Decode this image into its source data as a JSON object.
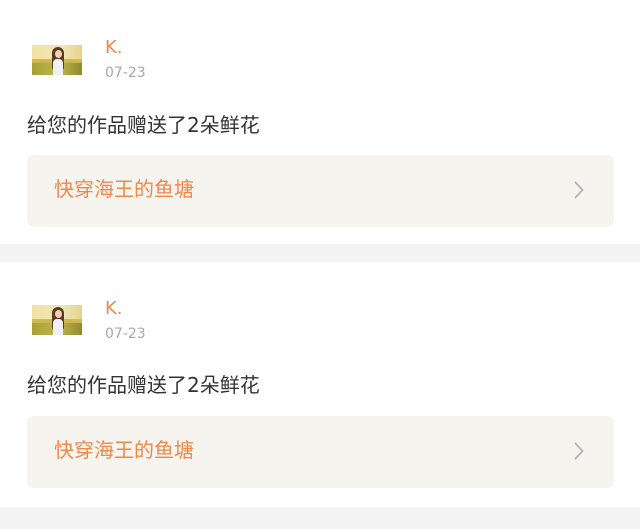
{
  "notifications": [
    {
      "username": "K.",
      "date": "07-23",
      "message": "给您的作品赠送了2朵鲜花",
      "work_title": "快穿海王的鱼塘"
    },
    {
      "username": "K.",
      "date": "07-23",
      "message": "给您的作品赠送了2朵鲜花",
      "work_title": "快穿海王的鱼塘"
    }
  ],
  "colors": {
    "accent": "#f0884a",
    "page_bg": "#f4f4f4",
    "card_bg": "#ffffff",
    "link_box_bg": "#f5f4ee",
    "text": "#333333",
    "muted": "#a8a8a8"
  },
  "icons": {
    "link_arrow": "chevron-right-icon"
  }
}
